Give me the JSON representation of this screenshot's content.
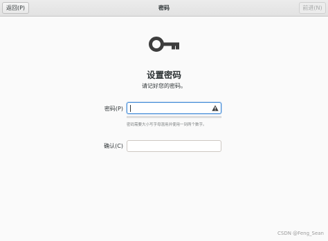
{
  "header": {
    "back_label": "返回(P)",
    "title": "密码",
    "next_label": "前进(N)"
  },
  "main": {
    "icon": "key-icon",
    "title": "设置密码",
    "subtitle": "请记好您的密码。"
  },
  "password_field": {
    "label": "密码(P)",
    "value": "",
    "warning_icon": "warning-icon",
    "hint": "密码需要大小写字母混用并使用一到两个数字。"
  },
  "confirm_field": {
    "label": "确认(C)",
    "value": ""
  },
  "watermark": "CSDN @Feng_Sean",
  "colors": {
    "focus": "#4a90d9",
    "icon": "#3d3d3d"
  }
}
